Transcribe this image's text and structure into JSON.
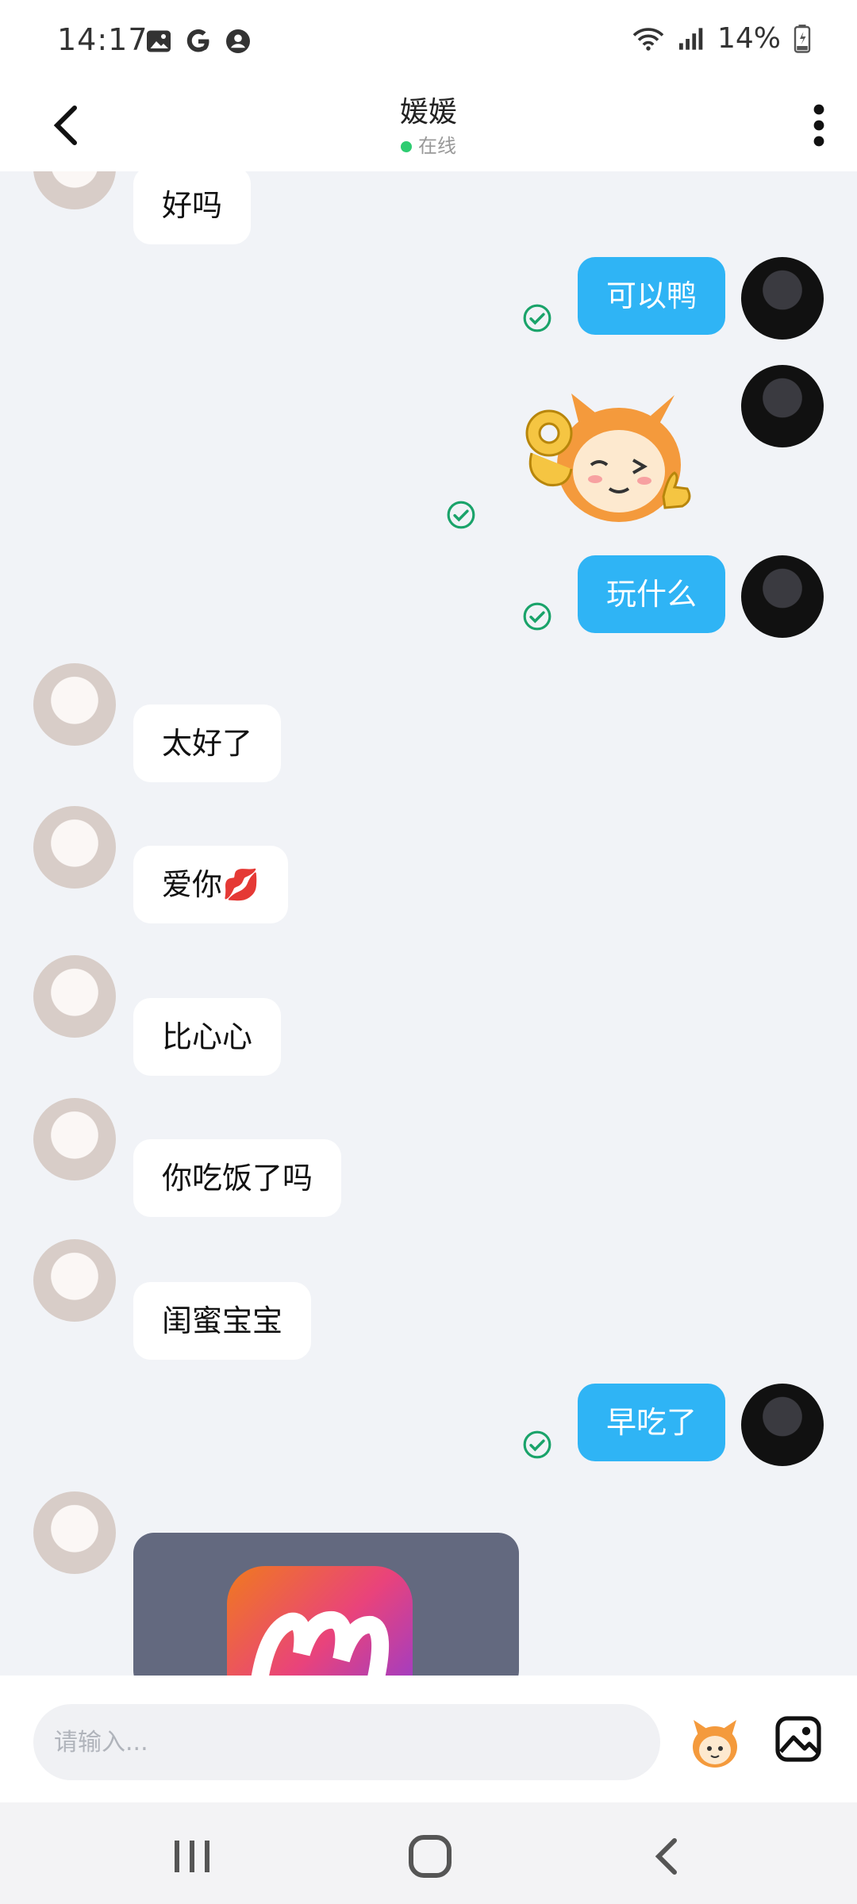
{
  "status_bar": {
    "time": "14:17",
    "battery": "14%",
    "icons": [
      "gallery-icon",
      "google-icon",
      "account-icon",
      "wifi-icon",
      "signal-icon",
      "battery-icon"
    ]
  },
  "header": {
    "title": "媛媛",
    "status": "在线",
    "status_color": "#2ecc71",
    "back_icon": "chevron-left-icon",
    "menu_icon": "more-vertical-icon"
  },
  "messages": [
    {
      "side": "in",
      "text": "好吗"
    },
    {
      "side": "out",
      "text": "可以鸭",
      "read": true
    },
    {
      "side": "out",
      "type": "sticker",
      "sticker": "ok-thumbs-up-mascot",
      "read": true
    },
    {
      "side": "out",
      "text": "玩什么",
      "read": true
    },
    {
      "side": "in",
      "text": "太好了"
    },
    {
      "side": "in",
      "text": "爱你",
      "emoji": "💋"
    },
    {
      "side": "in",
      "text": "比心心"
    },
    {
      "side": "in",
      "text": "你吃饭了吗"
    },
    {
      "side": "in",
      "text": "闺蜜宝宝"
    },
    {
      "side": "out",
      "text": "早吃了",
      "read": true
    },
    {
      "side": "in",
      "type": "app-card",
      "logo": "m-app-logo"
    }
  ],
  "input": {
    "placeholder": "请输入..."
  },
  "colors": {
    "out_bubble": "#2fb4f5",
    "in_bubble": "#ffffff",
    "read_check": "#1aa36a",
    "background": "#f1f3f7"
  }
}
